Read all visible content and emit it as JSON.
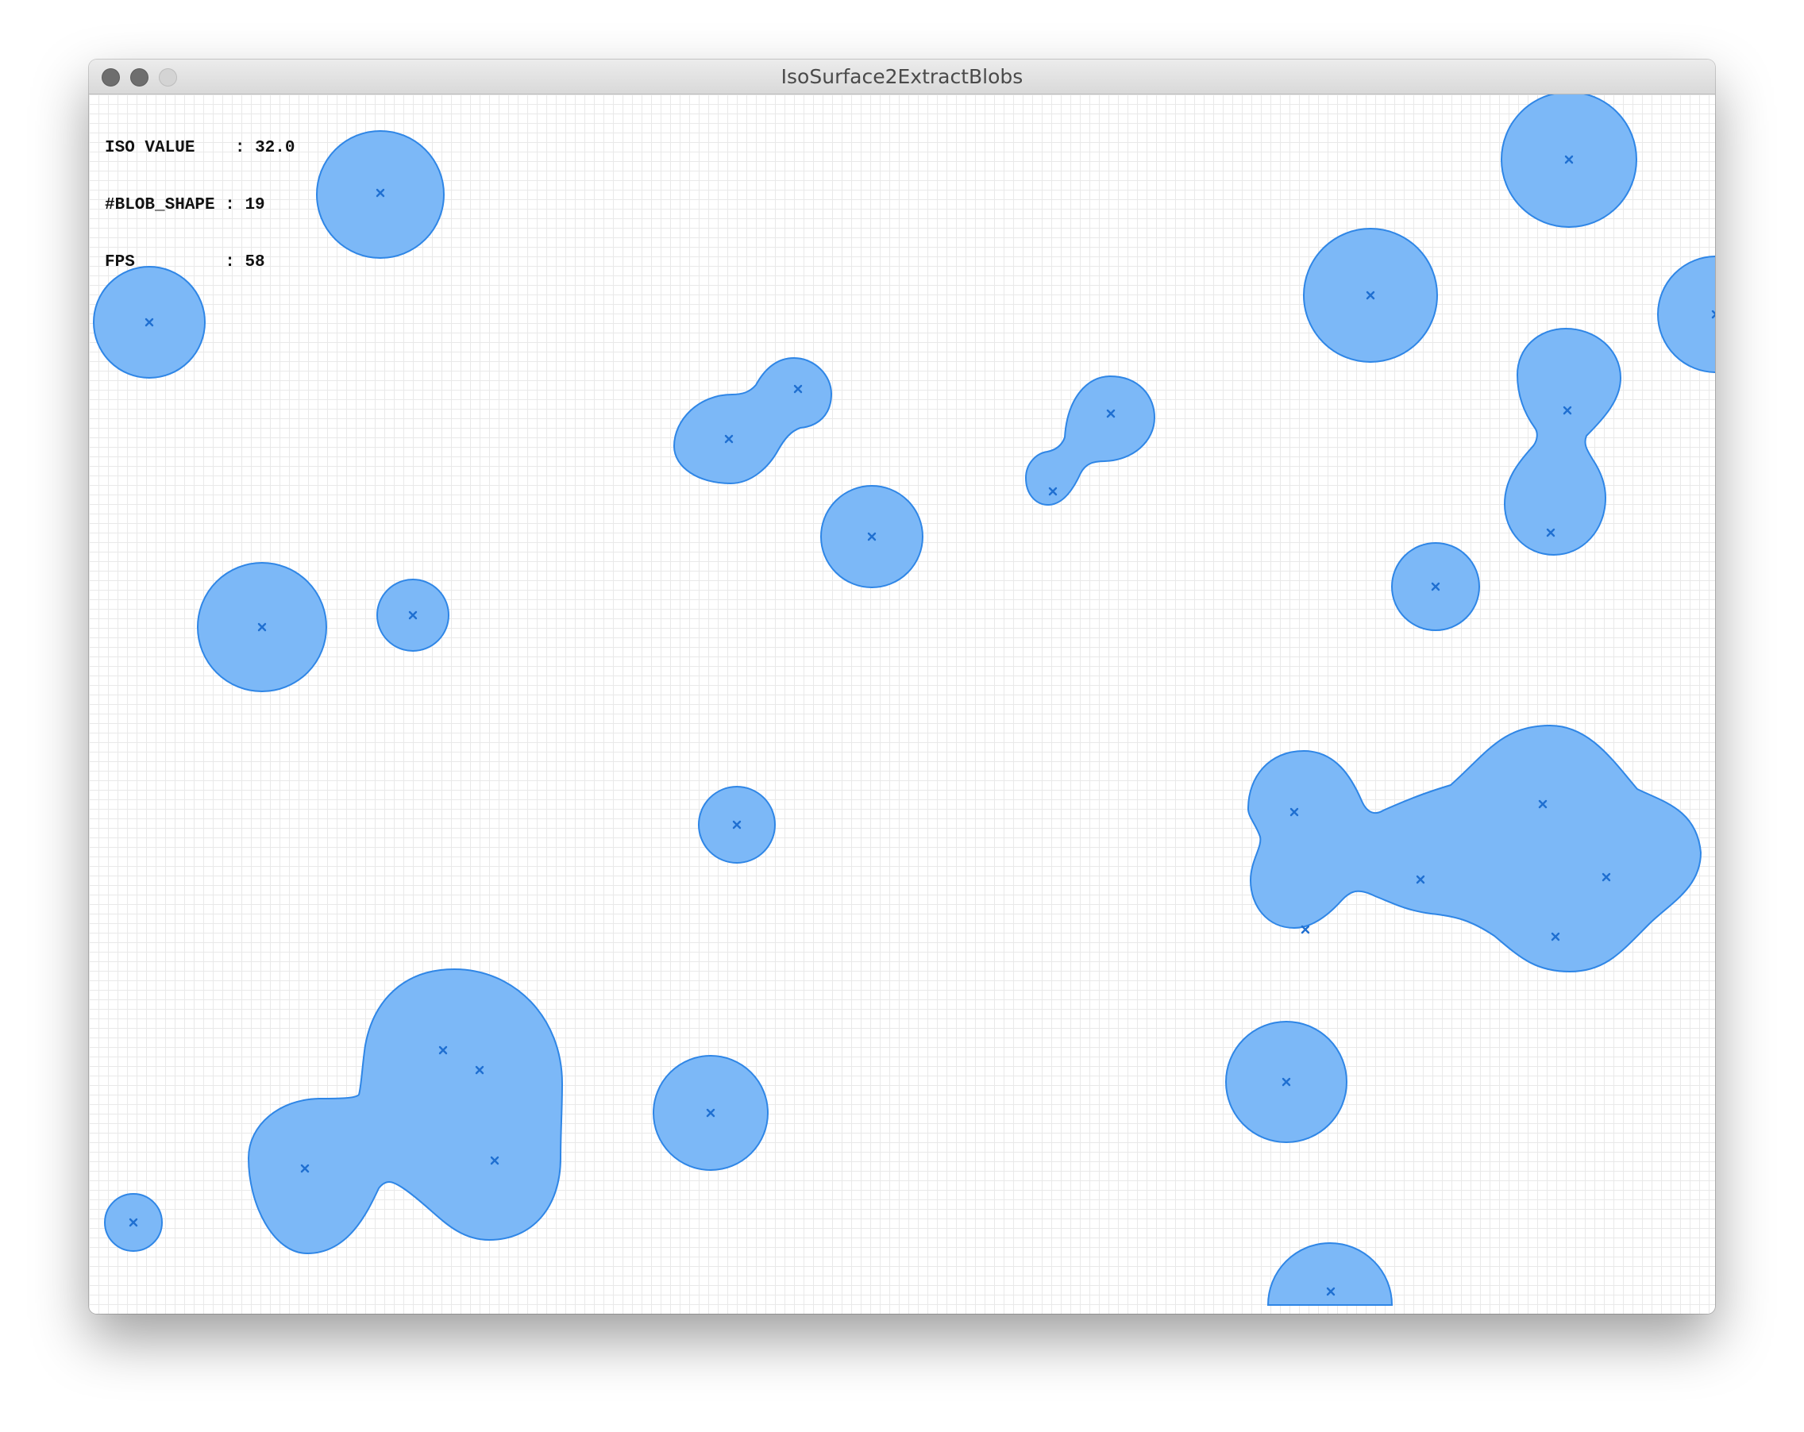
{
  "window": {
    "title": "IsoSurface2ExtractBlobs"
  },
  "hud": {
    "iso_label": "ISO VALUE",
    "iso_value": "32.0",
    "blob_label": "#BLOB_SHAPE",
    "blob_value": "19",
    "fps_label": "FPS",
    "fps_value": "58",
    "separator": ":"
  },
  "colors": {
    "blob_fill": "#7cb8f7",
    "blob_stroke": "#2f86e6",
    "marker": "#1f6fd1",
    "grid": "#e9e9e9"
  }
}
